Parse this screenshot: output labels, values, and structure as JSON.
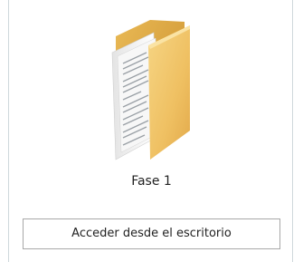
{
  "folder": {
    "icon": "folder-documents-icon",
    "label": "Fase 1"
  },
  "actions": {
    "access_desktop_label": "Acceder desde el escritorio"
  },
  "colors": {
    "folder_back": "#d9a441",
    "folder_front": "#f2c766",
    "border": "#cfd8dc"
  }
}
